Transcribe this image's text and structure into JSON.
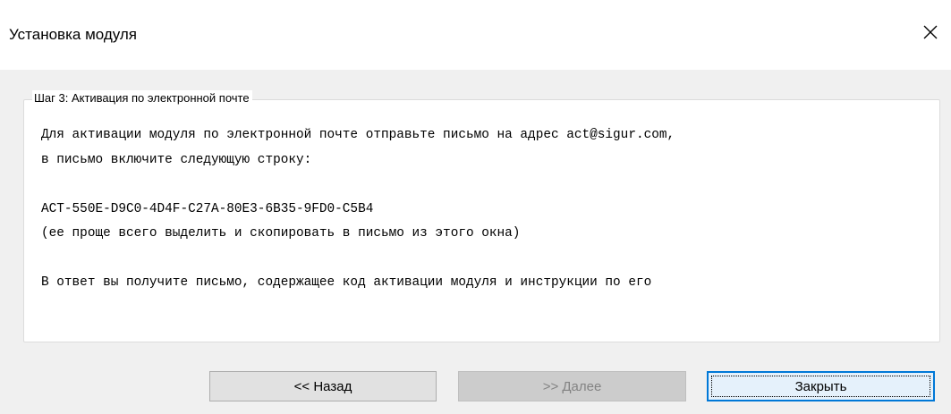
{
  "window": {
    "title": "Установка модуля",
    "close_glyph": "✕"
  },
  "step": {
    "legend": "Шаг 3: Активация по электронной почте",
    "lines": [
      "Для активации модуля по электронной почте отправьте письмо на адрес act@sigur.com,",
      "в письмо включите следующую строку:",
      "",
      "ACT-550E-D9C0-4D4F-C27A-80E3-6B35-9FD0-C5B4",
      "(ее проще всего выделить и скопировать в письмо из этого окна)",
      "",
      "В ответ вы получите письмо, содержащее код активации модуля и инструкции по его"
    ]
  },
  "buttons": {
    "back": "<< Назад",
    "next": ">> Далее",
    "close": "Закрыть"
  },
  "colors": {
    "dialog_bg": "#f0f0f0",
    "focus_blue": "#0078d7",
    "disabled_text": "#838383"
  },
  "icons": {
    "close": "close-icon"
  }
}
